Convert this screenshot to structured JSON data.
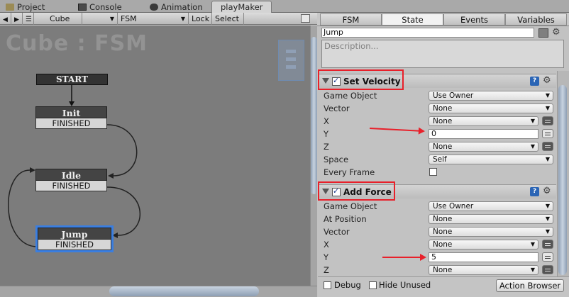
{
  "tabs": [
    {
      "label": "Project",
      "icon": "folder-icon"
    },
    {
      "label": "Console",
      "icon": "console-icon"
    },
    {
      "label": "Animation",
      "icon": "animation-icon"
    },
    {
      "label": "playMaker",
      "icon": ""
    }
  ],
  "toolbar": {
    "object": "Cube",
    "fsm": "FSM",
    "lock": "Lock",
    "select": "Select"
  },
  "canvas": {
    "title": "Cube : FSM",
    "start": "START",
    "states": [
      {
        "name": "Init",
        "transition": "FINISHED"
      },
      {
        "name": "Idle",
        "transition": "FINISHED"
      },
      {
        "name": "Jump",
        "transition": "FINISHED"
      }
    ],
    "selected_state": "Jump"
  },
  "panel": {
    "tabs": [
      "FSM",
      "State",
      "Events",
      "Variables"
    ],
    "selected_tab": "State",
    "state_name": "Jump",
    "description_placeholder": "Description...",
    "actions": [
      {
        "name": "Set Velocity",
        "enabled": true,
        "params": [
          {
            "label": "Game Object",
            "value": "Use Owner"
          },
          {
            "label": "Vector",
            "value": "None"
          },
          {
            "label": "X",
            "value": "None"
          },
          {
            "label": "Y",
            "value": "0"
          },
          {
            "label": "Z",
            "value": "None"
          },
          {
            "label": "Space",
            "value": "Self"
          },
          {
            "label": "Every Frame",
            "value": ""
          }
        ]
      },
      {
        "name": "Add Force",
        "enabled": true,
        "params": [
          {
            "label": "Game Object",
            "value": "Use Owner"
          },
          {
            "label": "At Position",
            "value": "None"
          },
          {
            "label": "Vector",
            "value": "None"
          },
          {
            "label": "X",
            "value": "None"
          },
          {
            "label": "Y",
            "value": "5"
          },
          {
            "label": "Z",
            "value": "None"
          }
        ]
      }
    ],
    "debug_label": "Debug",
    "hide_unused_label": "Hide Unused",
    "action_browser_label": "Action Browser"
  }
}
